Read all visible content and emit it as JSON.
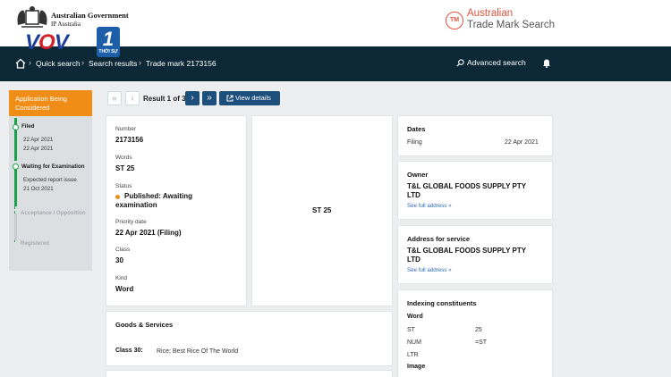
{
  "header": {
    "gov_title": "Australian Government",
    "gov_sub": "IP Australia",
    "watermark_text": "VOV",
    "watermark_number": "1",
    "watermark_sub": "THỜI SỰ",
    "brand_line1": "Australian",
    "brand_line2": "Trade Mark Search",
    "tm_badge": "TM",
    "brand_color": "#e0533d"
  },
  "nav": {
    "home_icon": "home-icon",
    "crumbs": [
      "Quick search",
      "Search results",
      "Trade mark 2173156"
    ],
    "separator": "›",
    "advanced_search": "Advanced search",
    "bg_color": "#0c2836"
  },
  "sidebar": {
    "status_header": "Application Being Considered",
    "header_color": "#ef8d16",
    "steps": [
      {
        "title": "Filed",
        "sub": "22 Apr 2021"
      },
      {
        "title": "Waiting for Examination",
        "sub": "Expected report issue",
        "sub2": "21 Oct 2021"
      },
      {
        "title": "Acceptance / Opposition"
      },
      {
        "title": "Registered"
      }
    ],
    "progress_color": "#1aa24a"
  },
  "pager": {
    "first": "«",
    "prev": "‹",
    "next": "›",
    "last": "»",
    "result_text": "Result 1 of 3",
    "view_details": "View details"
  },
  "details": {
    "number_label": "Number",
    "number": "2173156",
    "words_label": "Words",
    "words": "ST 25",
    "status_label": "Status",
    "status_line1": "Published: Awaiting",
    "status_line2": "examination",
    "status_color": "#e89320",
    "priority_label": "Priority date",
    "priority": "22 Apr 2021 (Filing)",
    "class_label": "Class",
    "class": "30",
    "kind_label": "Kind",
    "kind": "Word"
  },
  "image_preview": {
    "text": "ST 25"
  },
  "goods": {
    "title": "Goods & Services",
    "class_label": "Class 30:",
    "description": "Rice; Best Rice Of The World"
  },
  "dates": {
    "title": "Dates",
    "filing_label": "Filing",
    "filing_date": "22 Apr 2021"
  },
  "owner": {
    "title": "Owner",
    "name_line1": "T&L GLOBAL FOODS SUPPLY PTY",
    "name_line2": "LTD",
    "link": "See full address »"
  },
  "service": {
    "title": "Address for service",
    "name_line1": "T&L GLOBAL FOODS SUPPLY PTY",
    "name_line2": "LTD",
    "link": "See full address »"
  },
  "indexing": {
    "title": "Indexing constituents",
    "word_heading": "Word",
    "rows": [
      {
        "key": "ST",
        "value": "25"
      },
      {
        "key": "NUM",
        "value": "=ST"
      },
      {
        "key": "LTR",
        "value": ""
      }
    ],
    "image_heading": "Image"
  }
}
